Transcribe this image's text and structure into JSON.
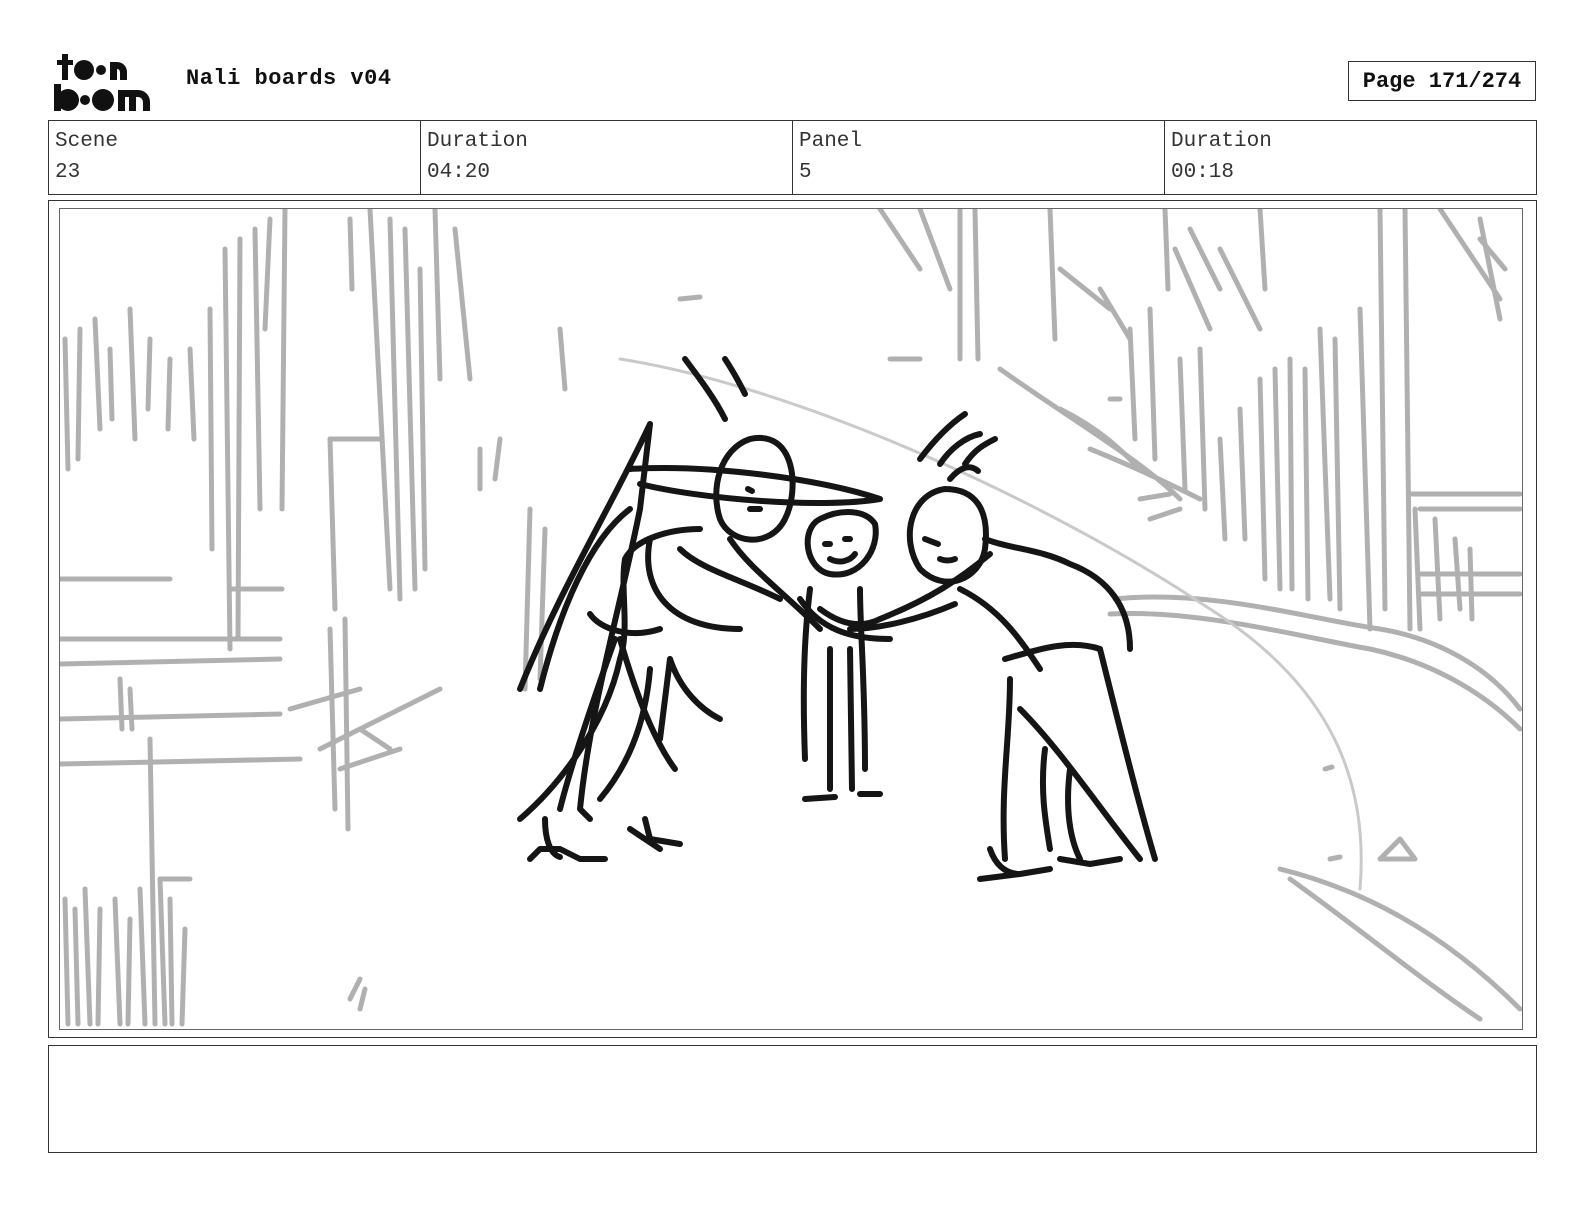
{
  "header": {
    "logo_text": "toon boom",
    "title": "Nali boards v04",
    "page_label": "Page 171/274"
  },
  "info": [
    {
      "label": "Scene",
      "value": "23"
    },
    {
      "label": "Duration",
      "value": "04:20"
    },
    {
      "label": "Panel",
      "value": "5"
    },
    {
      "label": "Duration",
      "value": "00:18"
    }
  ],
  "panel": {
    "image": "storyboard-sketch",
    "notes": ""
  },
  "colors": {
    "ink": "#111111",
    "background_sketch": "#a8a8a8",
    "border": "#333333"
  }
}
